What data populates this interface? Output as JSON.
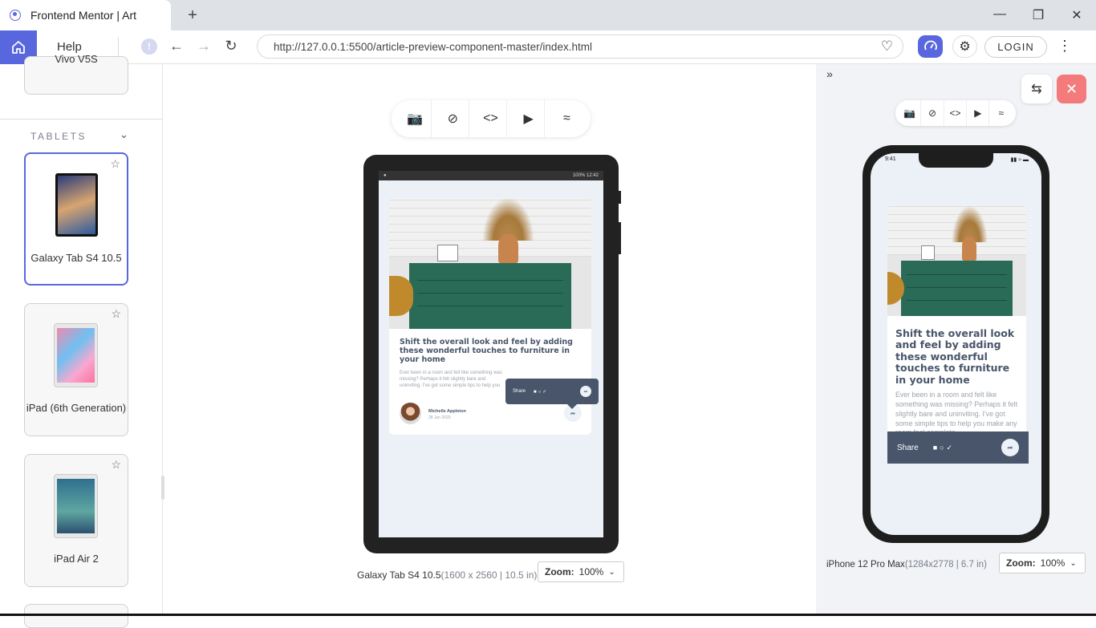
{
  "browser": {
    "tab_title": "Frontend Mentor | Art",
    "new_tab": "+",
    "url": "http://127.0.0.1:5500/article-preview-component-master/index.html",
    "help_label": "Help",
    "login_label": "LOGIN"
  },
  "sidebar": {
    "prev_device": "Vivo V5S",
    "section_title": "TABLETS",
    "devices": [
      {
        "name": "Galaxy Tab S4 10.5",
        "selected": true
      },
      {
        "name": "iPad (6th Generation)",
        "selected": false
      },
      {
        "name": "iPad Air 2",
        "selected": false
      }
    ]
  },
  "article": {
    "title": "Shift the overall look and feel by adding these wonderful touches to furniture in your home",
    "body": "Ever been in a room and felt like something was missing? Perhaps it felt slightly bare and uninviting. I've got some simple tips to help you make any room feel complete.",
    "body_truncated": "Ever been in a room and felt like something was missing? Perhaps it felt slightly bare and uninviting. I've got some simple tips to help you make any room feel complete.",
    "author": "Michelle Appleton",
    "date": "28 Jun 2020",
    "share_label": "Share"
  },
  "tablet_preview": {
    "status_right": "100% 12:42",
    "device_label": "Galaxy Tab S4 10.5",
    "device_dims": "(1600 x 2560 | 10.5 in)",
    "zoom_label": "Zoom:",
    "zoom_value": "100%"
  },
  "phone_preview": {
    "time": "9:41",
    "device_label": "iPhone 12 Pro Max",
    "device_dims": "(1284x2778 | 6.7 in)",
    "zoom_label": "Zoom:",
    "zoom_value": "100%"
  },
  "colors": {
    "accent": "#5867dd",
    "close": "#f47b7b",
    "article_heading": "#48556a",
    "share_bg": "#48556a",
    "panel_bg": "#f1f3f6"
  },
  "icons": {
    "toolbar": [
      "camera-icon",
      "rotate-icon",
      "code-icon",
      "video-icon",
      "wifi-icon"
    ]
  }
}
